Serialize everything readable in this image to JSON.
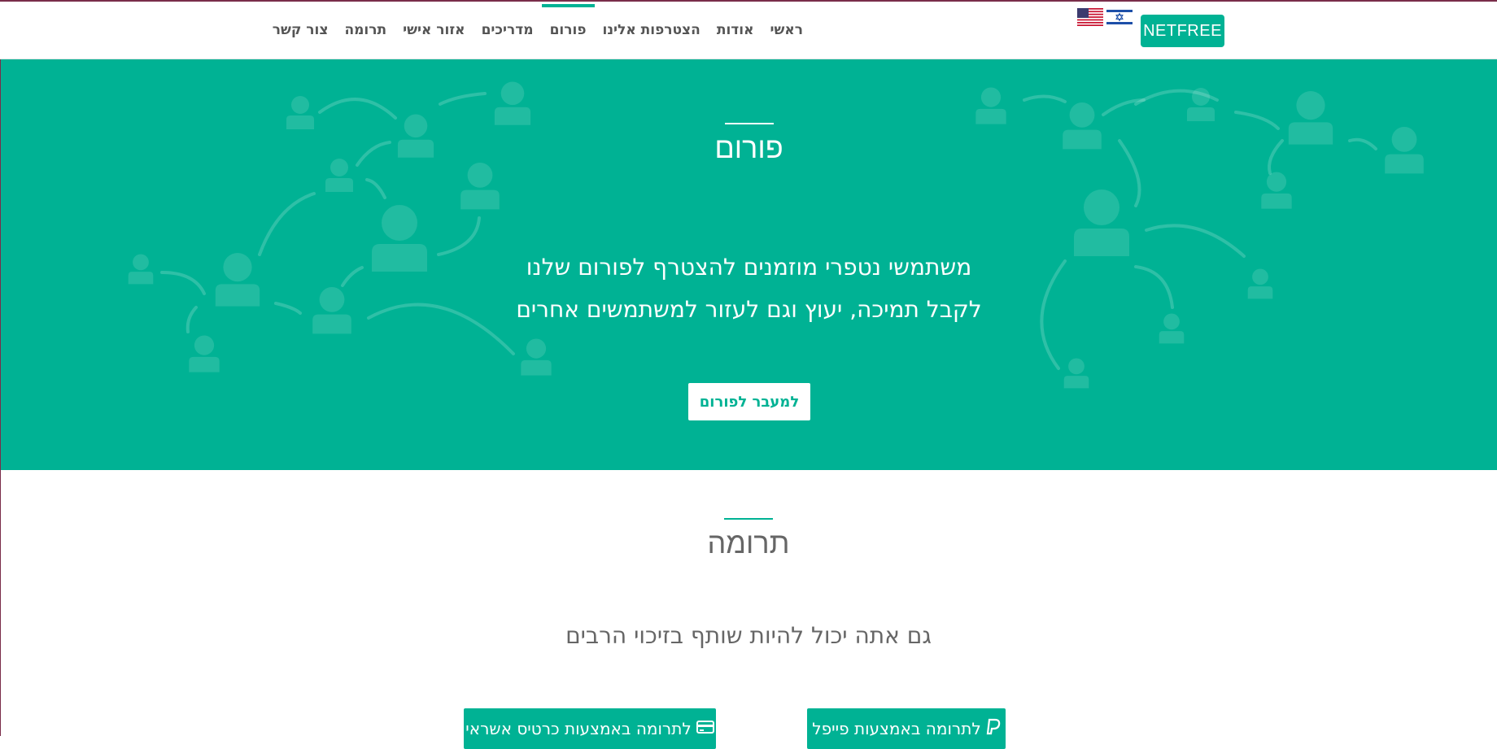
{
  "brand": {
    "logo_bold": "NET",
    "logo_light": "FREE"
  },
  "colors": {
    "accent": "#00b294",
    "frame": "#7a2d4a"
  },
  "header": {
    "nav": [
      {
        "label": "ראשי",
        "active": false
      },
      {
        "label": "אודות",
        "active": false
      },
      {
        "label": "הצטרפות אלינו",
        "active": false
      },
      {
        "label": "פורום",
        "active": true
      },
      {
        "label": "מדריכים",
        "active": false
      },
      {
        "label": "אזור אישי",
        "active": false
      },
      {
        "label": "תרומה",
        "active": false
      },
      {
        "label": "צור קשר",
        "active": false
      }
    ],
    "languages": [
      "hebrew-flag-icon",
      "us-flag-icon"
    ]
  },
  "forum": {
    "title": "פורום",
    "line1": "משתמשי נטפרי מוזמנים להצטרף לפורום שלנו",
    "line2": "לקבל תמיכה, יעוץ וגם לעזור למשתמשים אחרים",
    "button": "למעבר לפורום"
  },
  "donation": {
    "title": "תרומה",
    "subtitle": "גם אתה יכול להיות שותף בזיכוי הרבים",
    "paypal_button": "לתרומה באמצעות פייפל",
    "card_button": "לתרומה באמצעות כרטיס אשראי",
    "paypal_icon": "paypal-icon",
    "card_icon": "credit-card-icon"
  }
}
